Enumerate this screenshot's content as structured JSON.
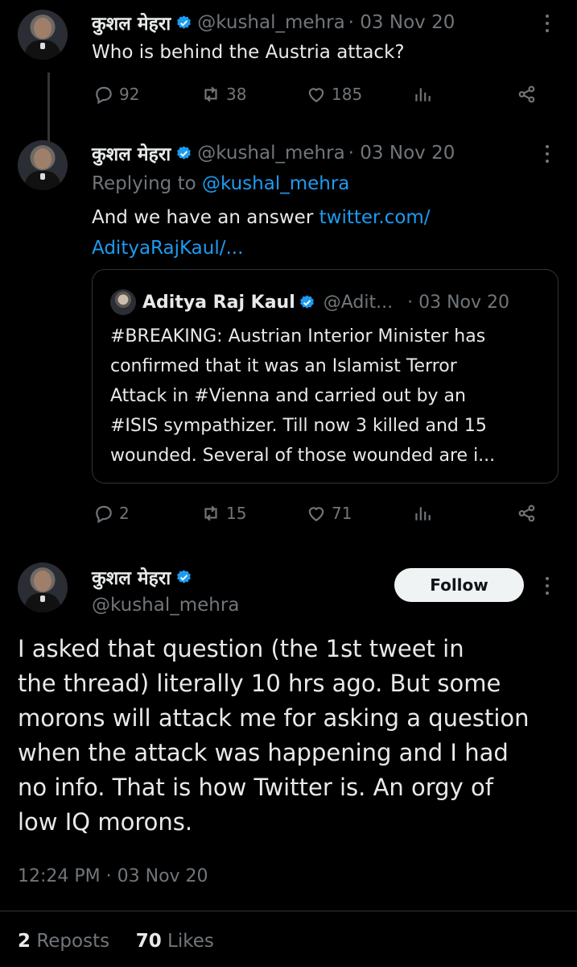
{
  "tweet1": {
    "name": "कुशल मेहरा",
    "handle": "@kushal_mehra",
    "date": "· 03 Nov 20",
    "text": "Who is behind the Austria attack?",
    "actions": {
      "replies": "92",
      "reposts": "38",
      "likes": "185"
    }
  },
  "tweet2": {
    "name": "कुशल मेहरा",
    "handle": "@kushal_mehra",
    "date": "· 03 Nov 20",
    "replying_prefix": "Replying to ",
    "replying_handle": "@kushal_mehra",
    "text_prefix": "And we have an answer ",
    "link_line1": "twitter.com/",
    "link_line2": "AdityaRajKaul/...",
    "quote": {
      "name": "Aditya Raj Kaul",
      "handle": "@Adit...",
      "date": "· 03 Nov 20",
      "lines": [
        "#BREAKING: Austrian Interior Minister has",
        "confirmed that it was an Islamist Terror",
        "Attack in #Vienna and carried out by an",
        "#ISIS sympathizer. Till now 3 killed and 15",
        "wounded. Several of those wounded are i..."
      ]
    },
    "actions": {
      "replies": "2",
      "reposts": "15",
      "likes": "71"
    }
  },
  "main_tweet": {
    "name": "कुशल मेहरा",
    "handle": "@kushal_mehra",
    "follow_label": "Follow",
    "lines": [
      "I asked that question (the 1st tweet in",
      "the thread) literally 10 hrs ago. But some",
      "morons will attack me for asking a question",
      "when the attack was happening and I had",
      "no info. That is how Twitter is. An orgy of",
      "low IQ morons."
    ],
    "time": "12:24 PM · 03 Nov 20",
    "reposts_count": "2",
    "reposts_label": "Reposts",
    "likes_count": "70",
    "likes_label": "Likes"
  },
  "icons": {
    "reply": "reply-icon",
    "repost": "repost-icon",
    "like": "heart-icon",
    "views": "views-icon",
    "share": "share-icon",
    "more": "more-icon",
    "verified": "verified-badge-icon"
  },
  "colors": {
    "background": "#000000",
    "text": "#e7e9ea",
    "muted": "#71767b",
    "link": "#1d9bf0",
    "verified": "#1d9bf0"
  }
}
